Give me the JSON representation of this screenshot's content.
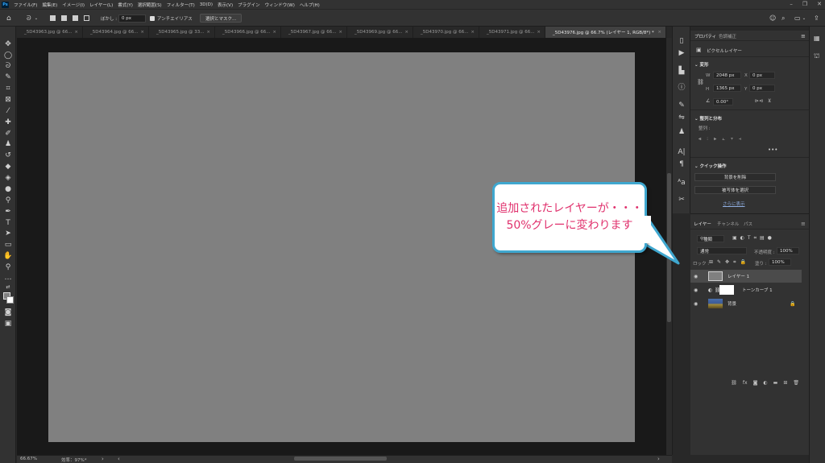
{
  "menubar": {
    "logo": "Ps",
    "items": [
      "ファイル(F)",
      "編集(E)",
      "イメージ(I)",
      "レイヤー(L)",
      "書式(Y)",
      "選択範囲(S)",
      "フィルター(T)",
      "3D(D)",
      "表示(V)",
      "プラグイン",
      "ウィンドウ(W)",
      "ヘルプ(H)"
    ]
  },
  "options": {
    "feather_label": "ぼかし :",
    "feather_value": "0 px",
    "antialias_label": "アンチエイリアス",
    "select_mask_label": "選択とマスク..."
  },
  "tabs": [
    "_5D43963.jpg @ 66...",
    "_5D43964.jpg @ 66...",
    "_5D43965.jpg @ 33...",
    "_5D43966.jpg @ 66...",
    "_5D43967.jpg @ 66...",
    "_5D43969.jpg @ 66...",
    "_5D43970.jpg @ 66...",
    "_5D43971.jpg @ 66...",
    "_5D43976.jpg @ 66.7% (レイヤー 1, RGB/8*) *"
  ],
  "status": {
    "zoom": "66.67%",
    "efficiency": "効率：97%*"
  },
  "properties": {
    "tab_properties": "プロパティ",
    "tab_color": "色調補正",
    "pixel_layer": "ピクセルレイヤー",
    "transform_title": "変形",
    "w_label": "W",
    "w_value": "2048 px",
    "x_label": "X",
    "x_value": "0 px",
    "h_label": "H",
    "h_value": "1365 px",
    "y_label": "Y",
    "y_value": "0 px",
    "angle_value": "0.00°",
    "align_title": "整列と分布",
    "align_label": "整列 :",
    "quick_title": "クイック操作",
    "remove_bg": "背景を削除",
    "select_subject": "被写体を選択",
    "more": "さらに表示"
  },
  "layers": {
    "tab_layers": "レイヤー",
    "tab_channels": "チャンネル",
    "tab_paths": "パス",
    "filter_kind": "種類",
    "blend_mode": "通常",
    "opacity_label": "不透明度 :",
    "opacity_value": "100%",
    "lock_label": "ロック :",
    "fill_label": "塗り :",
    "fill_value": "100%",
    "items": [
      {
        "name": "レイヤー 1"
      },
      {
        "name": "トーンカーブ 1"
      },
      {
        "name": "背景"
      }
    ]
  },
  "callout": {
    "line1": "追加されたレイヤーが・・・",
    "line2": "50%グレーに変わります"
  },
  "colors": {
    "canvas": "#808080",
    "callout_border": "#3fa7cf",
    "callout_text": "#e0316d"
  }
}
